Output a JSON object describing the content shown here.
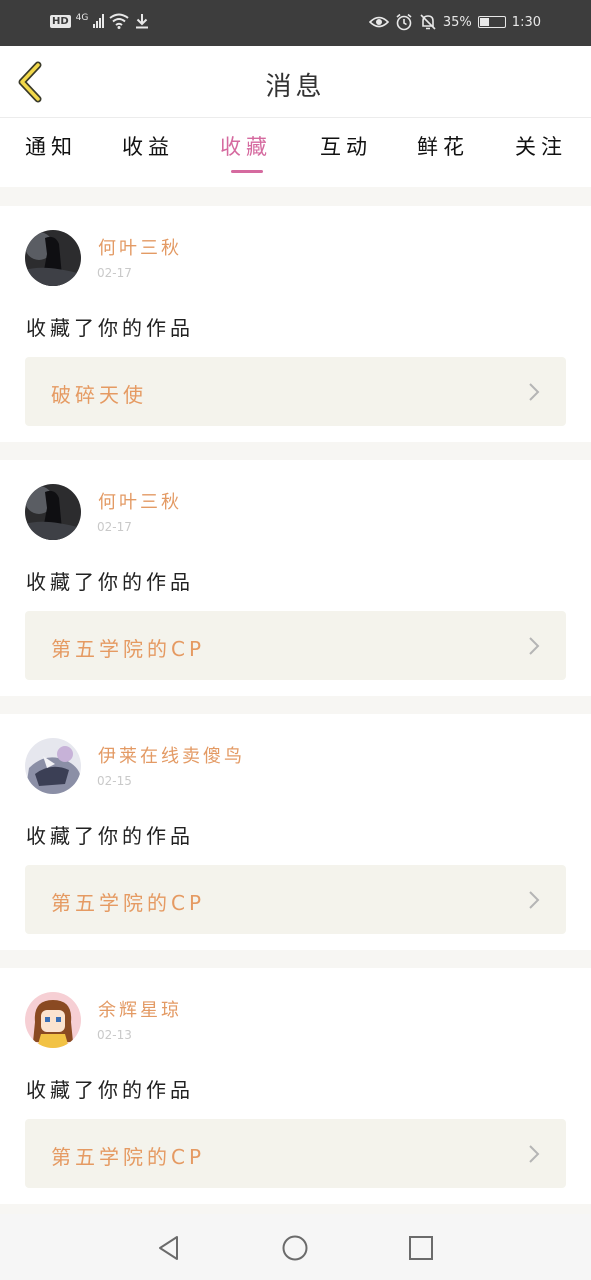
{
  "status_bar": {
    "network_badge": "HD",
    "network_type": "4G",
    "battery": "35%",
    "time": "1:30",
    "battery_level": 0.35,
    "icons": [
      "hd-icon",
      "signal-icon",
      "wifi-icon",
      "download-icon",
      "eye-icon",
      "alarm-icon",
      "mute-icon",
      "battery-icon"
    ]
  },
  "header": {
    "title": "消息",
    "back_icon": "chevron-left-icon"
  },
  "tabs": [
    {
      "label": "通知",
      "active": false
    },
    {
      "label": "收益",
      "active": false
    },
    {
      "label": "收藏",
      "active": true
    },
    {
      "label": "互动",
      "active": false
    },
    {
      "label": "鲜花",
      "active": false
    },
    {
      "label": "关注",
      "active": false
    }
  ],
  "colors": {
    "accent": "#d56a9f",
    "username": "#e39a64",
    "work_title": "#e59a62",
    "work_bg": "#f4f3ec",
    "list_bg": "#f7f6f3"
  },
  "messages": [
    {
      "user": "何叶三秋",
      "date": "02-17",
      "action": "收藏了你的作品",
      "work": "破碎天使"
    },
    {
      "user": "何叶三秋",
      "date": "02-17",
      "action": "收藏了你的作品",
      "work": "第五学院的CP"
    },
    {
      "user": "伊莱在线卖傻鸟",
      "date": "02-15",
      "action": "收藏了你的作品",
      "work": "第五学院的CP"
    },
    {
      "user": "余辉星琼",
      "date": "02-13",
      "action": "收藏了你的作品",
      "work": "第五学院的CP"
    }
  ],
  "nav_bar": [
    "back-triangle-icon",
    "home-circle-icon",
    "recents-square-icon"
  ]
}
